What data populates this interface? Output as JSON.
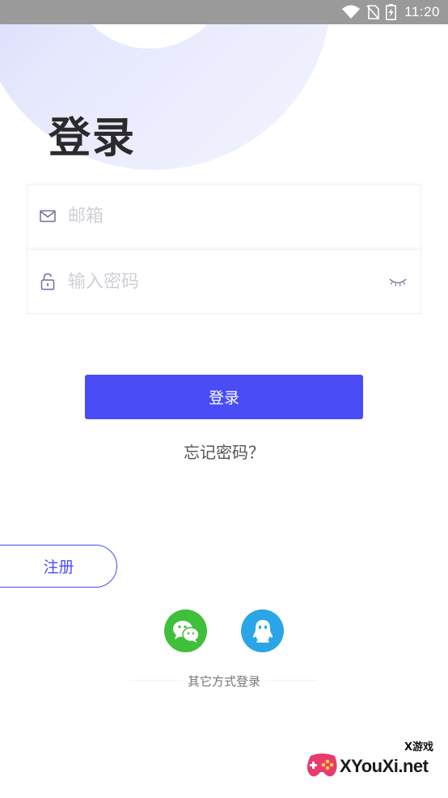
{
  "status_bar": {
    "time": "11:20"
  },
  "login": {
    "title": "登录",
    "email_placeholder": "邮箱",
    "password_placeholder": "输入密码",
    "login_button": "登录",
    "forgot_password": "忘记密码？",
    "register_button": "注册",
    "other_login_label": "其它方式登录"
  },
  "social": {
    "wechat_icon": "wechat-icon",
    "qq_icon": "qq-icon"
  },
  "watermark": {
    "cn": "X游戏",
    "text": "XYouXi.net"
  },
  "colors": {
    "accent": "#4a4cf6",
    "wechat": "#3fbf3a",
    "qq": "#2aa6e8"
  }
}
